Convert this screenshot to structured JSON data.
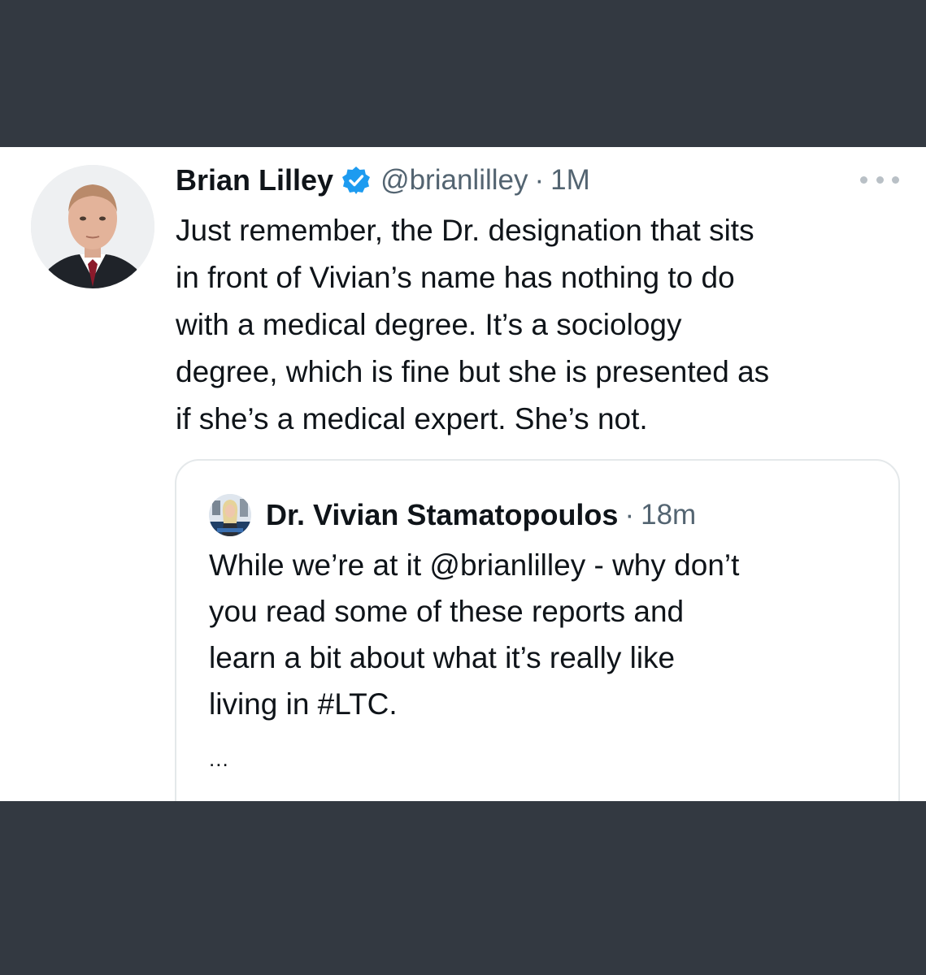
{
  "tweet": {
    "author_name": "Brian Lilley",
    "verified": true,
    "handle": "@brianlilley",
    "separator": "·",
    "time": "1M",
    "text": "Just remember, the Dr. designation that sits\nin front of Vivian’s name has nothing to do\nwith a medical degree. It’s a sociology\ndegree, which is fine but she is presented as\nif she’s a medical expert. She’s not.",
    "more_icon": "more-horizontal-icon"
  },
  "quoted_tweet": {
    "author_name": "Dr. Vivian Stamatopoulos",
    "separator": "·",
    "time": "18m",
    "text": "While we’re at it @brianlilley - why don’t\nyou read some of these reports and\nlearn a bit about what it’s really like\nliving in #LTC.",
    "ellipsis": "..."
  },
  "colors": {
    "background": "#333941",
    "card": "#ffffff",
    "text_primary": "#0f1419",
    "text_secondary": "#536471",
    "verified_badge": "#1d9bf0",
    "card_border": "#e4e8ea"
  }
}
